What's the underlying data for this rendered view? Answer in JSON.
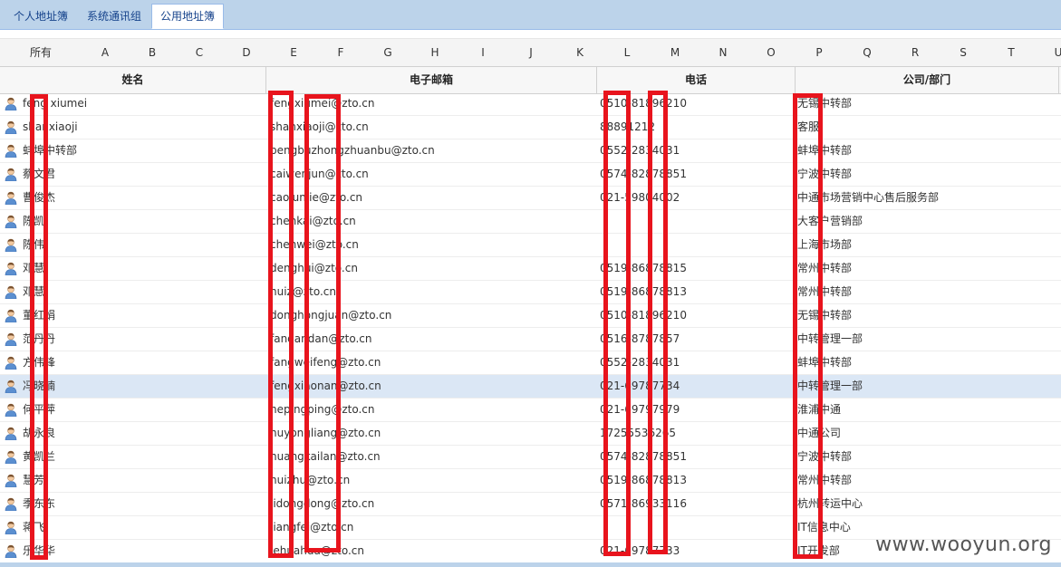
{
  "tabs": [
    "个人地址簿",
    "系统通讯组",
    "公用地址簿"
  ],
  "alphabet": [
    "所有",
    "A",
    "B",
    "C",
    "D",
    "E",
    "F",
    "G",
    "H",
    "I",
    "J",
    "K",
    "L",
    "M",
    "N",
    "O",
    "P",
    "Q",
    "R",
    "S",
    "T",
    "U"
  ],
  "columns": [
    "姓名",
    "电子邮箱",
    "电话",
    "公司/部门"
  ],
  "rows": [
    {
      "name": "feng xiumei",
      "email": "fengxiumei@zto.cn",
      "phone": "0510-81896210",
      "dept": "无锡中转部"
    },
    {
      "name": "shanxiaoji",
      "email": "shanxiaoji@zto.cn",
      "phone": "88891212",
      "dept": "客服"
    },
    {
      "name": "蚌埠中转部",
      "email": "bengbuzhongzhuanbu@zto.cn",
      "phone": "0552-2834031",
      "dept": "蚌埠中转部"
    },
    {
      "name": "蔡文君",
      "email": "caiwenjun@zto.cn",
      "phone": "0574-82878851",
      "dept": "宁波中转部"
    },
    {
      "name": "曹俊杰",
      "email": "caojunjie@zto.cn",
      "phone": "021-59804002",
      "dept": "中通市场营销中心售后服务部"
    },
    {
      "name": "陈凯",
      "email": "chenkai@zto.cn",
      "phone": "",
      "dept": "大客户营销部"
    },
    {
      "name": "陈伟",
      "email": "chenwei@zto.cn",
      "phone": "",
      "dept": "上海市场部"
    },
    {
      "name": "邓慧",
      "email": "denghui@zto.cn",
      "phone": "0519-86878815",
      "dept": "常州中转部"
    },
    {
      "name": "邓慧",
      "email": "huiz@zto.cn",
      "phone": "0519-86878813",
      "dept": "常州中转部"
    },
    {
      "name": "董红娟",
      "email": "donghongjuan@zto.cn",
      "phone": "0510-81896210",
      "dept": "无锡中转部"
    },
    {
      "name": "范丹丹",
      "email": "fandandan@zto.cn",
      "phone": "0516-8787857",
      "dept": "中转管理一部"
    },
    {
      "name": "方伟锋",
      "email": "fangweifeng@zto.cn",
      "phone": "0552-2834031",
      "dept": "蚌埠中转部"
    },
    {
      "name": "冯晓楠",
      "email": "fengxiaonan@zto.cn",
      "phone": "021-69787734",
      "dept": "中转管理一部"
    },
    {
      "name": "何平萍",
      "email": "hepingping@zto.cn",
      "phone": "021-69797979",
      "dept": "淮浦中通"
    },
    {
      "name": "胡永良",
      "email": "huyongliang@zto.cn",
      "phone": "17255536265",
      "dept": "中通公司"
    },
    {
      "name": "黄凯兰",
      "email": "huangkailan@zto.cn",
      "phone": "0574-82878851",
      "dept": "宁波中转部"
    },
    {
      "name": "慧芳",
      "email": "huizhu@zto.cn",
      "phone": "0519-86878813",
      "dept": "常州中转部"
    },
    {
      "name": "季东东",
      "email": "jidongdong@zto.cn",
      "phone": "0571-86933116",
      "dept": "杭州转运中心"
    },
    {
      "name": "蒋飞",
      "email": "jiangfei@zto.cn",
      "phone": "",
      "dept": "IT信息中心"
    },
    {
      "name": "乐华华",
      "email": "lehuahua@zto.cn",
      "phone": "021-69787733",
      "dept": "IT开发部"
    }
  ],
  "selected_row": 12,
  "watermark": "www.wooyun.org"
}
